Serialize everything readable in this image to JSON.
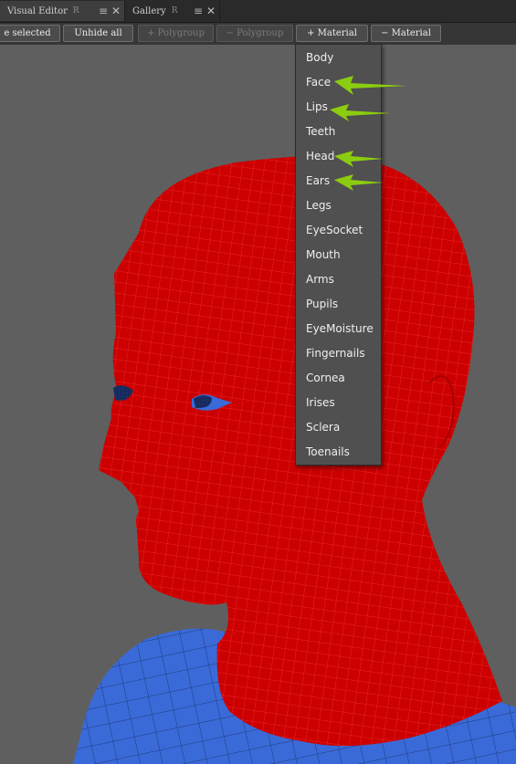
{
  "tabs": [
    {
      "label": "Visual Editor",
      "pin": "R",
      "menu_icon": "≡",
      "close_icon": "✕",
      "active": true
    },
    {
      "label": "Gallery",
      "pin": "R",
      "menu_icon": "≡",
      "close_icon": "✕",
      "active": false
    }
  ],
  "toolbar": {
    "hide_selected": "e selected",
    "unhide_all": "Unhide all",
    "add_polygroup": "+ Polygroup",
    "remove_polygroup": "− Polygroup",
    "add_material": "+ Material",
    "remove_material": "− Material"
  },
  "material_menu": {
    "items": [
      "Body",
      "Face",
      "Lips",
      "Teeth",
      "Head",
      "Ears",
      "Legs",
      "EyeSocket",
      "Mouth",
      "Arms",
      "Pupils",
      "EyeMoisture",
      "Fingernails",
      "Cornea",
      "Irises",
      "Sclera",
      "Toenails"
    ],
    "highlighted_with_arrows": [
      "Face",
      "Lips",
      "Head",
      "Ears"
    ]
  },
  "colors": {
    "selected_mesh": "#cc0000",
    "unselected_mesh": "#3a6ad8",
    "annotation_arrow": "#8ccc10",
    "background": "#5f5f5f"
  }
}
